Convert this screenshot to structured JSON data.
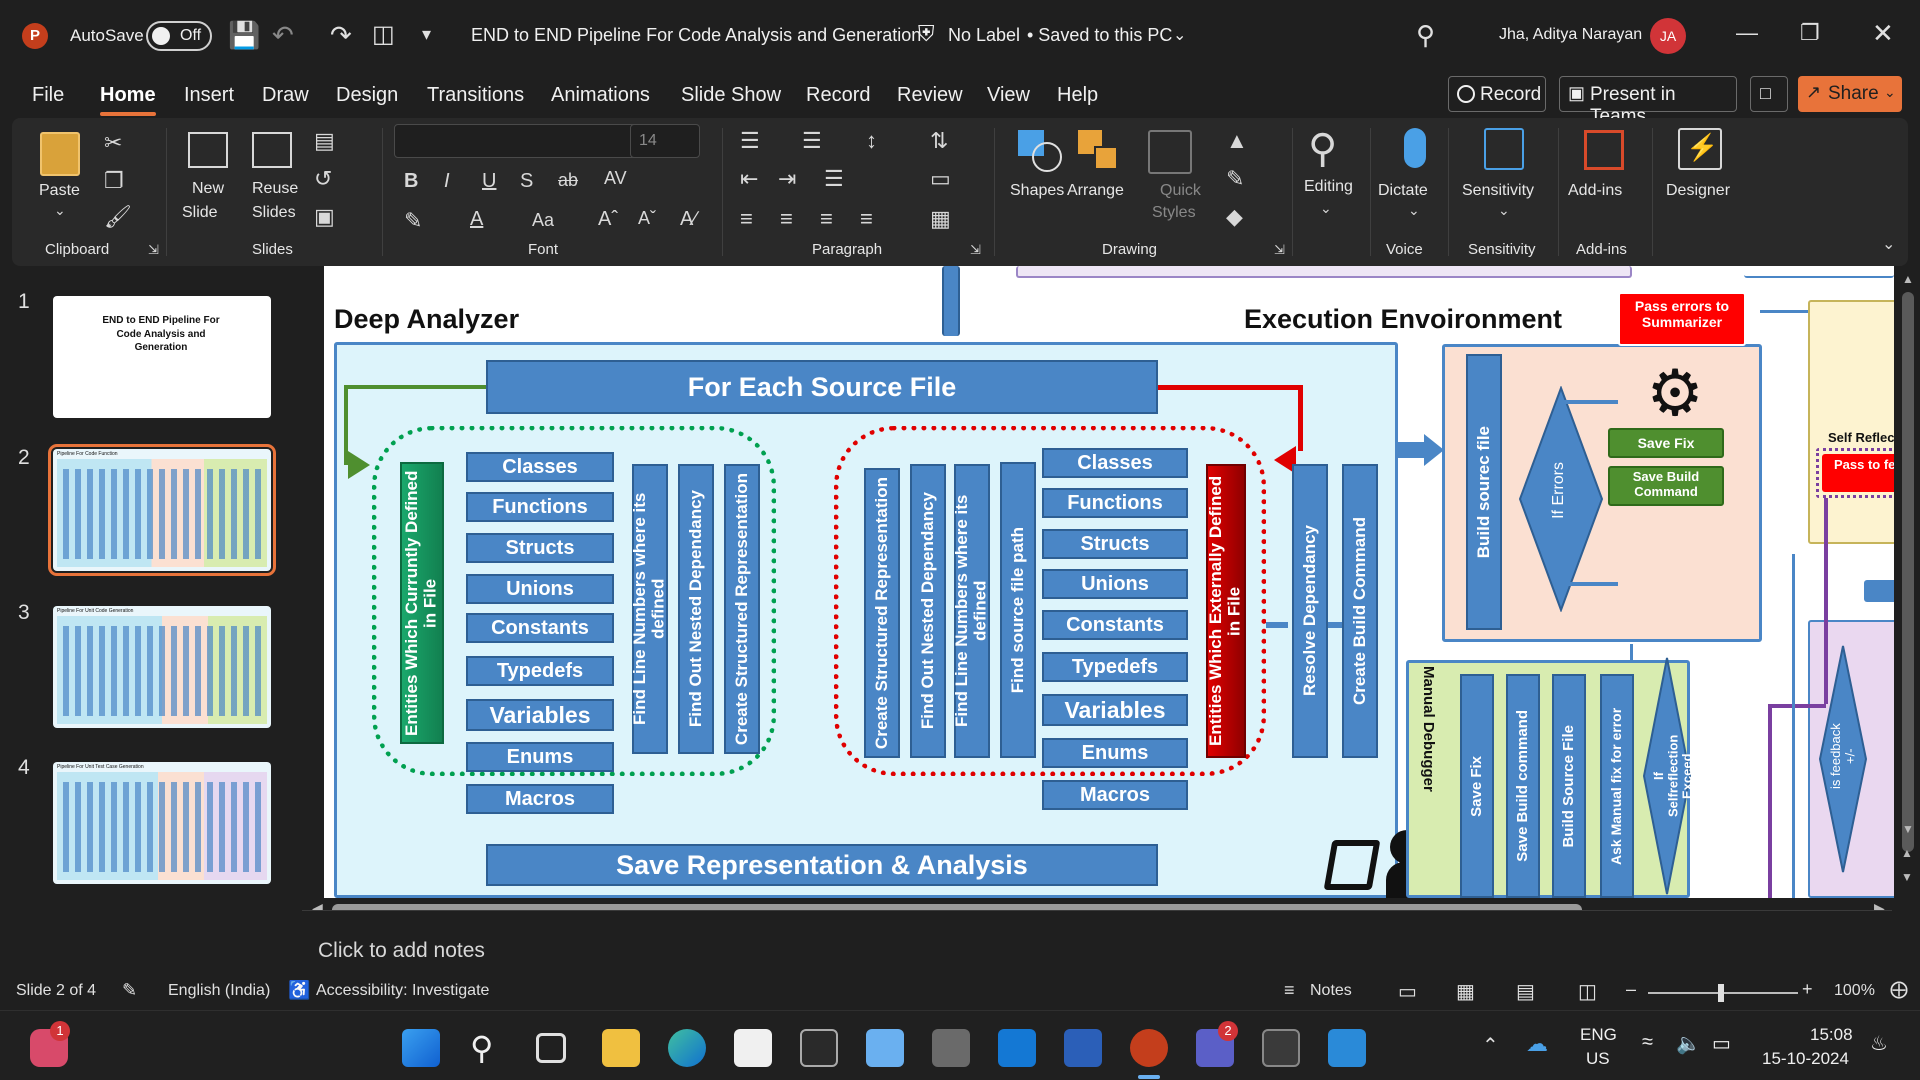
{
  "titlebar": {
    "autosave_label": "AutoSave",
    "autosave_state": "Off",
    "doc_title": "END to END Pipeline For Code Analysis and Generation",
    "label_status": "No Label",
    "save_status": "• Saved to this PC",
    "user_name": "Jha, Aditya Narayan",
    "user_initials": "JA"
  },
  "menu": {
    "tabs": [
      "File",
      "Home",
      "Insert",
      "Draw",
      "Design",
      "Transitions",
      "Animations",
      "Slide Show",
      "Record",
      "Review",
      "View",
      "Help"
    ],
    "record_button": "Record",
    "present_button": "Present in Teams",
    "share_button": "Share"
  },
  "ribbon": {
    "paste": "Paste",
    "clipboard": "Clipboard",
    "new_slide_1": "New",
    "new_slide_2": "Slide",
    "reuse_1": "Reuse",
    "reuse_2": "Slides",
    "slides": "Slides",
    "font_size": "14",
    "font": "Font",
    "paragraph": "Paragraph",
    "shapes": "Shapes",
    "arrange": "Arrange",
    "quick_1": "Quick",
    "quick_2": "Styles",
    "drawing": "Drawing",
    "editing": "Editing",
    "dictate": "Dictate",
    "voice": "Voice",
    "sensitivity": "Sensitivity",
    "sensitivity_group": "Sensitivity",
    "addins": "Add-ins",
    "addins_group": "Add-ins",
    "designer": "Designer"
  },
  "thumbnails": {
    "numbers": [
      "1",
      "2",
      "3",
      "4"
    ],
    "slide1_title": "END to END Pipeline For Code Analysis and Generation",
    "slide2_title": "Pipeline For Code Function",
    "slide3_title": "Pipeline For Unit Code Generation",
    "slide4_title": "Pipeline For Unit Test Case Generation"
  },
  "slide": {
    "deep_title": "Deep Analyzer",
    "exec_title": "Execution Envoironment",
    "for_each": "For Each Source File",
    "save_rep": "Save Representation & Analysis",
    "left_entities": "Entities Which Curruntly Defined in File",
    "left_items": [
      "Classes",
      "Functions",
      "Structs",
      "Unions",
      "Constants",
      "Typedefs",
      "Variables",
      "Enums",
      "Macros"
    ],
    "left_bars": [
      "Find Line Numbers where its defined",
      "Find Out Nested Dependancy",
      "Create Structured Representation"
    ],
    "right_bars": [
      "Create Structured Representation",
      "Find Out Nested Dependancy",
      "Find Line Numbers where its defined",
      "Find source file path"
    ],
    "right_items": [
      "Classes",
      "Functions",
      "Structs",
      "Unions",
      "Constants",
      "Typedefs",
      "Variables",
      "Enums",
      "Macros"
    ],
    "right_entities": "Entities Which Externally Defined in File",
    "resolve": "Resolve Dependancy",
    "create_build": "Create Build Command",
    "build_source": "Build sourec file",
    "if_errors": "If Errors",
    "pass_errors": "Pass errors to Summarizer",
    "save_fix": "Save Fix",
    "save_build_cmd": "Save Build Command",
    "manual_debugger": "Manual Debugger",
    "dbg_bars": [
      "Save Fix",
      "Save Build command",
      "Build Source File",
      "Ask Manual fix for error"
    ],
    "if_selfreflection": "If Selfreflection Exceed",
    "is_feedback": "is feedback +/-",
    "self_reflection": "Self Reflection",
    "pass_to_fe": "Pass to fe"
  },
  "notes": {
    "placeholder": "Click to add notes"
  },
  "status": {
    "slide_count": "Slide 2 of 4",
    "language": "English (India)",
    "accessibility": "Accessibility: Investigate",
    "notes": "Notes",
    "zoom": "100%"
  },
  "taskbar": {
    "lang_1": "ENG",
    "lang_2": "US",
    "time": "15:08",
    "date": "15-10-2024",
    "teams_badge": "2",
    "chat_badge": "1"
  },
  "colors": {
    "accent_orange": "#c43e1c",
    "share_orange": "#e8733a",
    "shape_blue": "#4a86c6",
    "deep_bg": "#ddf4fb",
    "exec_bg": "#fbe0d2",
    "debug_bg": "#d8ecb0",
    "green_entity": "#1aa86c",
    "red_entity": "#c00000"
  }
}
